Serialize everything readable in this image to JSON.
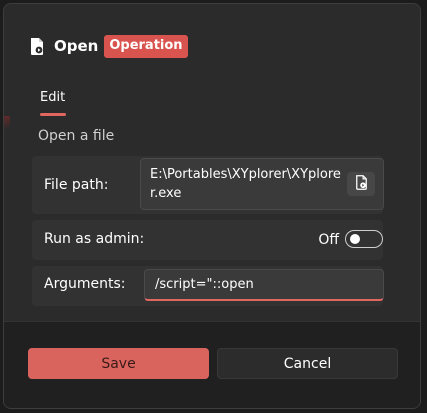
{
  "dialog": {
    "title": "Open",
    "badge": "Operation",
    "title_icon": "file-open-icon"
  },
  "tabs": [
    {
      "label": "Edit",
      "active": true
    }
  ],
  "section": {
    "title": "Open a file"
  },
  "fields": {
    "file_path": {
      "label": "File path:",
      "value": "E:\\Portables\\XYplorer\\XYplorer.exe",
      "browse_icon": "file-open-icon"
    },
    "run_as_admin": {
      "label": "Run as admin:",
      "state_label": "Off",
      "checked": false
    },
    "arguments": {
      "label": "Arguments:",
      "value": "/script=\"::open"
    }
  },
  "buttons": {
    "save": "Save",
    "cancel": "Cancel"
  },
  "colors": {
    "accent": "#d9645e",
    "badge": "#d9534f",
    "background": "#2b2b2b"
  }
}
